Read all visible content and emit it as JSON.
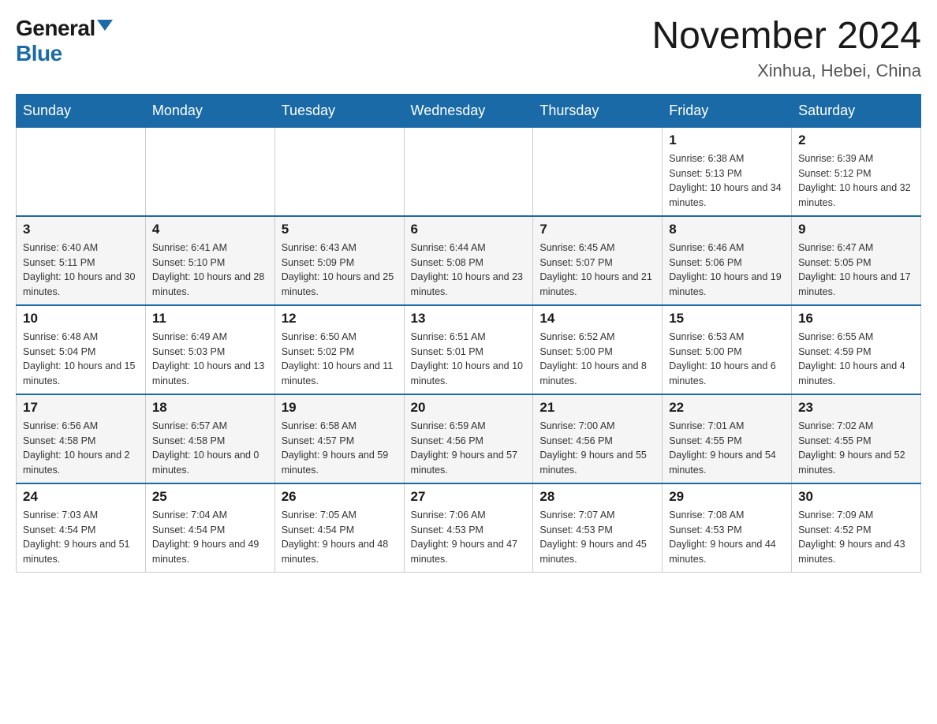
{
  "logo": {
    "general": "General",
    "blue": "Blue"
  },
  "title": "November 2024",
  "subtitle": "Xinhua, Hebei, China",
  "weekdays": [
    "Sunday",
    "Monday",
    "Tuesday",
    "Wednesday",
    "Thursday",
    "Friday",
    "Saturday"
  ],
  "weeks": [
    [
      {
        "day": "",
        "info": ""
      },
      {
        "day": "",
        "info": ""
      },
      {
        "day": "",
        "info": ""
      },
      {
        "day": "",
        "info": ""
      },
      {
        "day": "",
        "info": ""
      },
      {
        "day": "1",
        "info": "Sunrise: 6:38 AM\nSunset: 5:13 PM\nDaylight: 10 hours and 34 minutes."
      },
      {
        "day": "2",
        "info": "Sunrise: 6:39 AM\nSunset: 5:12 PM\nDaylight: 10 hours and 32 minutes."
      }
    ],
    [
      {
        "day": "3",
        "info": "Sunrise: 6:40 AM\nSunset: 5:11 PM\nDaylight: 10 hours and 30 minutes."
      },
      {
        "day": "4",
        "info": "Sunrise: 6:41 AM\nSunset: 5:10 PM\nDaylight: 10 hours and 28 minutes."
      },
      {
        "day": "5",
        "info": "Sunrise: 6:43 AM\nSunset: 5:09 PM\nDaylight: 10 hours and 25 minutes."
      },
      {
        "day": "6",
        "info": "Sunrise: 6:44 AM\nSunset: 5:08 PM\nDaylight: 10 hours and 23 minutes."
      },
      {
        "day": "7",
        "info": "Sunrise: 6:45 AM\nSunset: 5:07 PM\nDaylight: 10 hours and 21 minutes."
      },
      {
        "day": "8",
        "info": "Sunrise: 6:46 AM\nSunset: 5:06 PM\nDaylight: 10 hours and 19 minutes."
      },
      {
        "day": "9",
        "info": "Sunrise: 6:47 AM\nSunset: 5:05 PM\nDaylight: 10 hours and 17 minutes."
      }
    ],
    [
      {
        "day": "10",
        "info": "Sunrise: 6:48 AM\nSunset: 5:04 PM\nDaylight: 10 hours and 15 minutes."
      },
      {
        "day": "11",
        "info": "Sunrise: 6:49 AM\nSunset: 5:03 PM\nDaylight: 10 hours and 13 minutes."
      },
      {
        "day": "12",
        "info": "Sunrise: 6:50 AM\nSunset: 5:02 PM\nDaylight: 10 hours and 11 minutes."
      },
      {
        "day": "13",
        "info": "Sunrise: 6:51 AM\nSunset: 5:01 PM\nDaylight: 10 hours and 10 minutes."
      },
      {
        "day": "14",
        "info": "Sunrise: 6:52 AM\nSunset: 5:00 PM\nDaylight: 10 hours and 8 minutes."
      },
      {
        "day": "15",
        "info": "Sunrise: 6:53 AM\nSunset: 5:00 PM\nDaylight: 10 hours and 6 minutes."
      },
      {
        "day": "16",
        "info": "Sunrise: 6:55 AM\nSunset: 4:59 PM\nDaylight: 10 hours and 4 minutes."
      }
    ],
    [
      {
        "day": "17",
        "info": "Sunrise: 6:56 AM\nSunset: 4:58 PM\nDaylight: 10 hours and 2 minutes."
      },
      {
        "day": "18",
        "info": "Sunrise: 6:57 AM\nSunset: 4:58 PM\nDaylight: 10 hours and 0 minutes."
      },
      {
        "day": "19",
        "info": "Sunrise: 6:58 AM\nSunset: 4:57 PM\nDaylight: 9 hours and 59 minutes."
      },
      {
        "day": "20",
        "info": "Sunrise: 6:59 AM\nSunset: 4:56 PM\nDaylight: 9 hours and 57 minutes."
      },
      {
        "day": "21",
        "info": "Sunrise: 7:00 AM\nSunset: 4:56 PM\nDaylight: 9 hours and 55 minutes."
      },
      {
        "day": "22",
        "info": "Sunrise: 7:01 AM\nSunset: 4:55 PM\nDaylight: 9 hours and 54 minutes."
      },
      {
        "day": "23",
        "info": "Sunrise: 7:02 AM\nSunset: 4:55 PM\nDaylight: 9 hours and 52 minutes."
      }
    ],
    [
      {
        "day": "24",
        "info": "Sunrise: 7:03 AM\nSunset: 4:54 PM\nDaylight: 9 hours and 51 minutes."
      },
      {
        "day": "25",
        "info": "Sunrise: 7:04 AM\nSunset: 4:54 PM\nDaylight: 9 hours and 49 minutes."
      },
      {
        "day": "26",
        "info": "Sunrise: 7:05 AM\nSunset: 4:54 PM\nDaylight: 9 hours and 48 minutes."
      },
      {
        "day": "27",
        "info": "Sunrise: 7:06 AM\nSunset: 4:53 PM\nDaylight: 9 hours and 47 minutes."
      },
      {
        "day": "28",
        "info": "Sunrise: 7:07 AM\nSunset: 4:53 PM\nDaylight: 9 hours and 45 minutes."
      },
      {
        "day": "29",
        "info": "Sunrise: 7:08 AM\nSunset: 4:53 PM\nDaylight: 9 hours and 44 minutes."
      },
      {
        "day": "30",
        "info": "Sunrise: 7:09 AM\nSunset: 4:52 PM\nDaylight: 9 hours and 43 minutes."
      }
    ]
  ]
}
